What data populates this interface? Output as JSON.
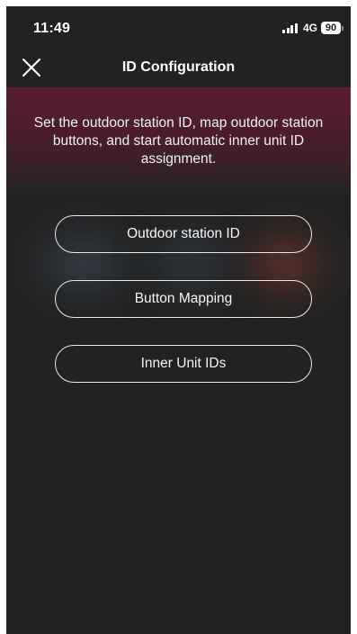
{
  "status_bar": {
    "time": "11:49",
    "network": "4G",
    "battery": "90"
  },
  "nav": {
    "title": "ID Configuration",
    "close_icon": "close-icon"
  },
  "banner": {
    "description": "Set the outdoor station ID, map outdoor station buttons, and start automatic inner unit ID assignment."
  },
  "menu": {
    "items": [
      {
        "label": "Outdoor station ID"
      },
      {
        "label": "Button Mapping"
      },
      {
        "label": "Inner Unit IDs"
      }
    ]
  },
  "colors": {
    "background": "#222222",
    "banner": "#5a1f33",
    "text": "#ffffff",
    "button_border": "#e8e8e8"
  }
}
